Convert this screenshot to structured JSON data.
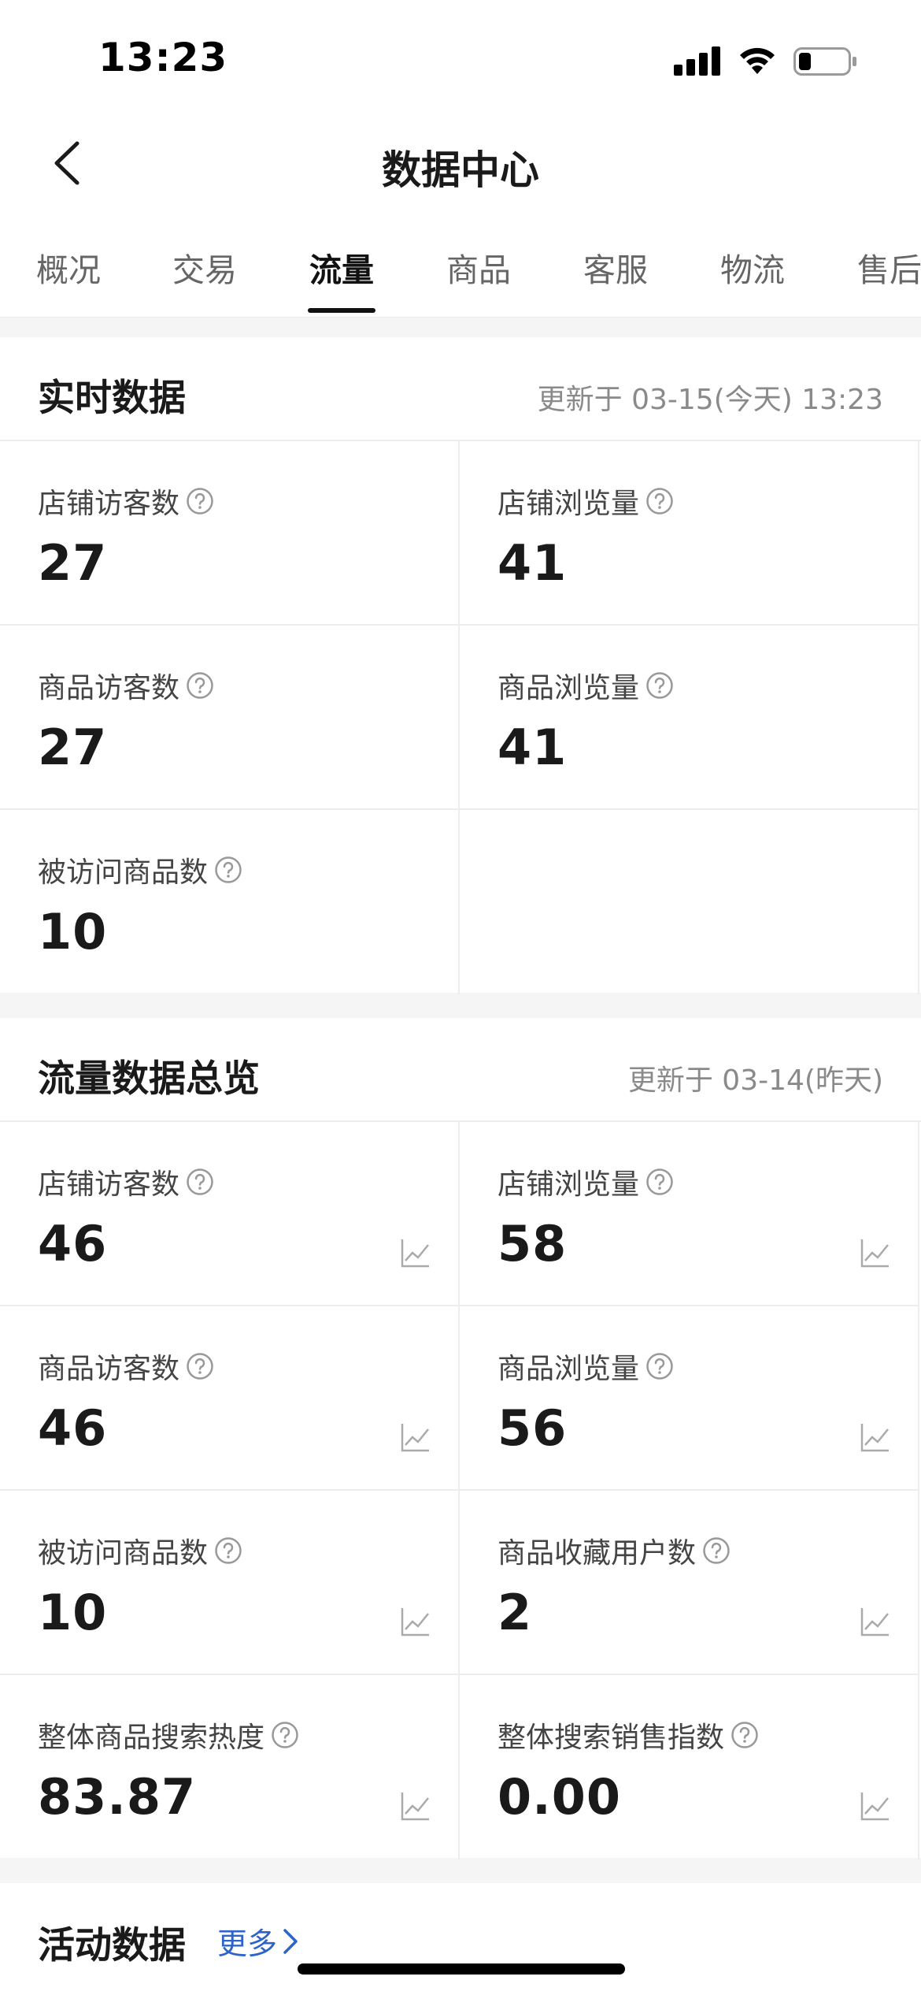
{
  "status_bar": {
    "time": "13:23"
  },
  "nav": {
    "title": "数据中心"
  },
  "tabs": [
    {
      "label": "概况"
    },
    {
      "label": "交易"
    },
    {
      "label": "流量"
    },
    {
      "label": "商品"
    },
    {
      "label": "客服"
    },
    {
      "label": "物流"
    },
    {
      "label": "售后"
    }
  ],
  "active_tab": "流量",
  "realtime": {
    "title": "实时数据",
    "updated": "更新于 03-15(今天) 13:23",
    "metrics": [
      {
        "label": "店铺访客数",
        "value": "27"
      },
      {
        "label": "店铺浏览量",
        "value": "41"
      },
      {
        "label": "商品访客数",
        "value": "27"
      },
      {
        "label": "商品浏览量",
        "value": "41"
      },
      {
        "label": "被访问商品数",
        "value": "10"
      }
    ]
  },
  "overview": {
    "title": "流量数据总览",
    "updated": "更新于 03-14(昨天)",
    "metrics": [
      {
        "label": "店铺访客数",
        "value": "46"
      },
      {
        "label": "店铺浏览量",
        "value": "58"
      },
      {
        "label": "商品访客数",
        "value": "46"
      },
      {
        "label": "商品浏览量",
        "value": "56"
      },
      {
        "label": "被访问商品数",
        "value": "10"
      },
      {
        "label": "商品收藏用户数",
        "value": "2"
      },
      {
        "label": "整体商品搜索热度",
        "value": "83.87"
      },
      {
        "label": "整体搜索销售指数",
        "value": "0.00"
      }
    ]
  },
  "activity": {
    "title": "活动数据",
    "more_label": "更多"
  },
  "colors": {
    "link": "#2e64c8",
    "divider": "#ededed",
    "background": "#f5f5f5"
  }
}
